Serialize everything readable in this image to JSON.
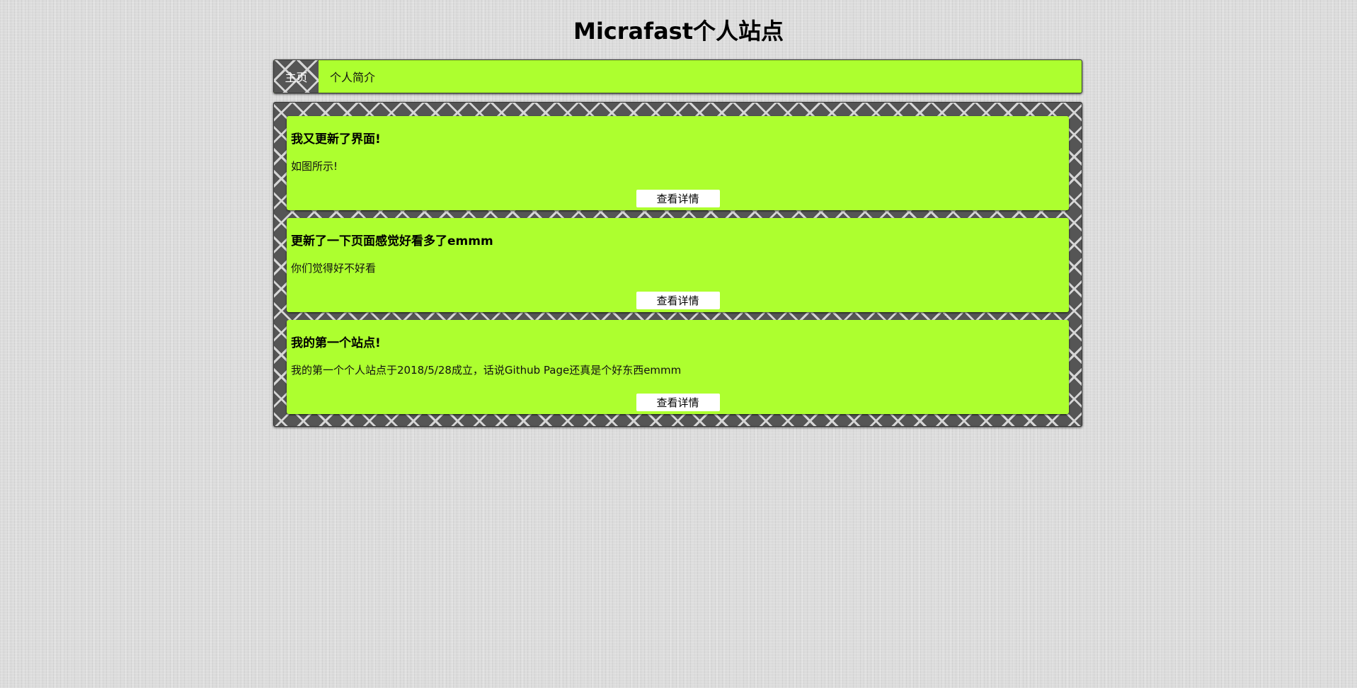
{
  "site": {
    "title": "Micrafast个人站点"
  },
  "nav": {
    "items": [
      {
        "label": "主页"
      },
      {
        "label": "个人简介"
      }
    ]
  },
  "posts": [
    {
      "title": "我又更新了界面!",
      "excerpt": "如图所示!",
      "button_label": "查看详情"
    },
    {
      "title": "更新了一下页面感觉好看多了emmm",
      "excerpt": "你们觉得好不好看",
      "button_label": "查看详情"
    },
    {
      "title": "我的第一个站点!",
      "excerpt": "我的第一个个人站点于2018/5/28成立，话说Github Page还真是个好东西emmm",
      "button_label": "查看详情"
    }
  ],
  "colors": {
    "accent": "#adff2f",
    "panel_dark": "#555555",
    "background": "#dcdcdc"
  }
}
